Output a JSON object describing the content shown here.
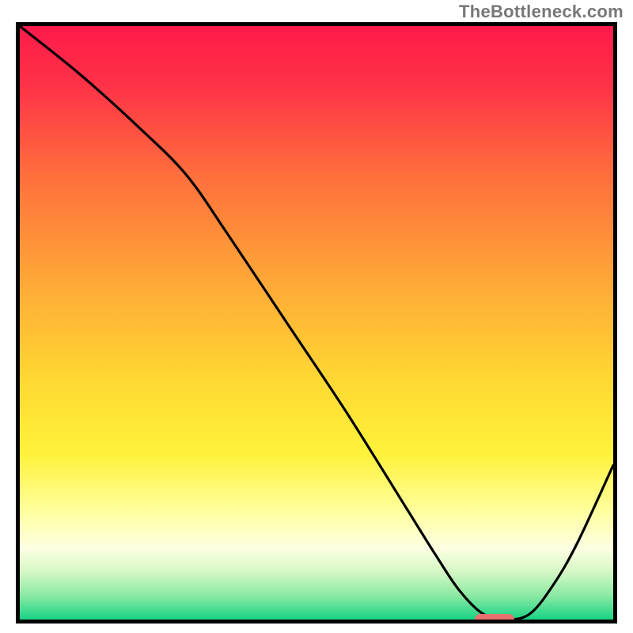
{
  "watermark": "TheBottleneck.com",
  "chart_data": {
    "type": "line",
    "title": "",
    "xlabel": "",
    "ylabel": "",
    "xlim": [
      0,
      100
    ],
    "ylim": [
      0,
      100
    ],
    "grid": false,
    "legend": false,
    "curve": {
      "name": "bottleneck-curve",
      "x": [
        0,
        10,
        20,
        28,
        35,
        45,
        55,
        65,
        70,
        74,
        78,
        82,
        86,
        90,
        94,
        100
      ],
      "y": [
        100,
        92,
        83,
        75,
        65,
        50,
        35,
        19,
        11,
        5,
        1,
        0,
        1,
        6,
        13,
        26
      ]
    },
    "marker": {
      "name": "optimal-marker",
      "x": 80,
      "y": 0,
      "color": "#e8716e"
    },
    "background_gradient": {
      "stops": [
        {
          "offset": 0,
          "color": "#ff1a4a"
        },
        {
          "offset": 0.1,
          "color": "#ff3247"
        },
        {
          "offset": 0.25,
          "color": "#ff6e3d"
        },
        {
          "offset": 0.45,
          "color": "#ffae36"
        },
        {
          "offset": 0.6,
          "color": "#ffd933"
        },
        {
          "offset": 0.72,
          "color": "#fff23a"
        },
        {
          "offset": 0.82,
          "color": "#ffffa0"
        },
        {
          "offset": 0.88,
          "color": "#fdffe2"
        },
        {
          "offset": 0.92,
          "color": "#d4f7c4"
        },
        {
          "offset": 0.96,
          "color": "#8ae9a3"
        },
        {
          "offset": 1.0,
          "color": "#17d384"
        }
      ]
    }
  }
}
